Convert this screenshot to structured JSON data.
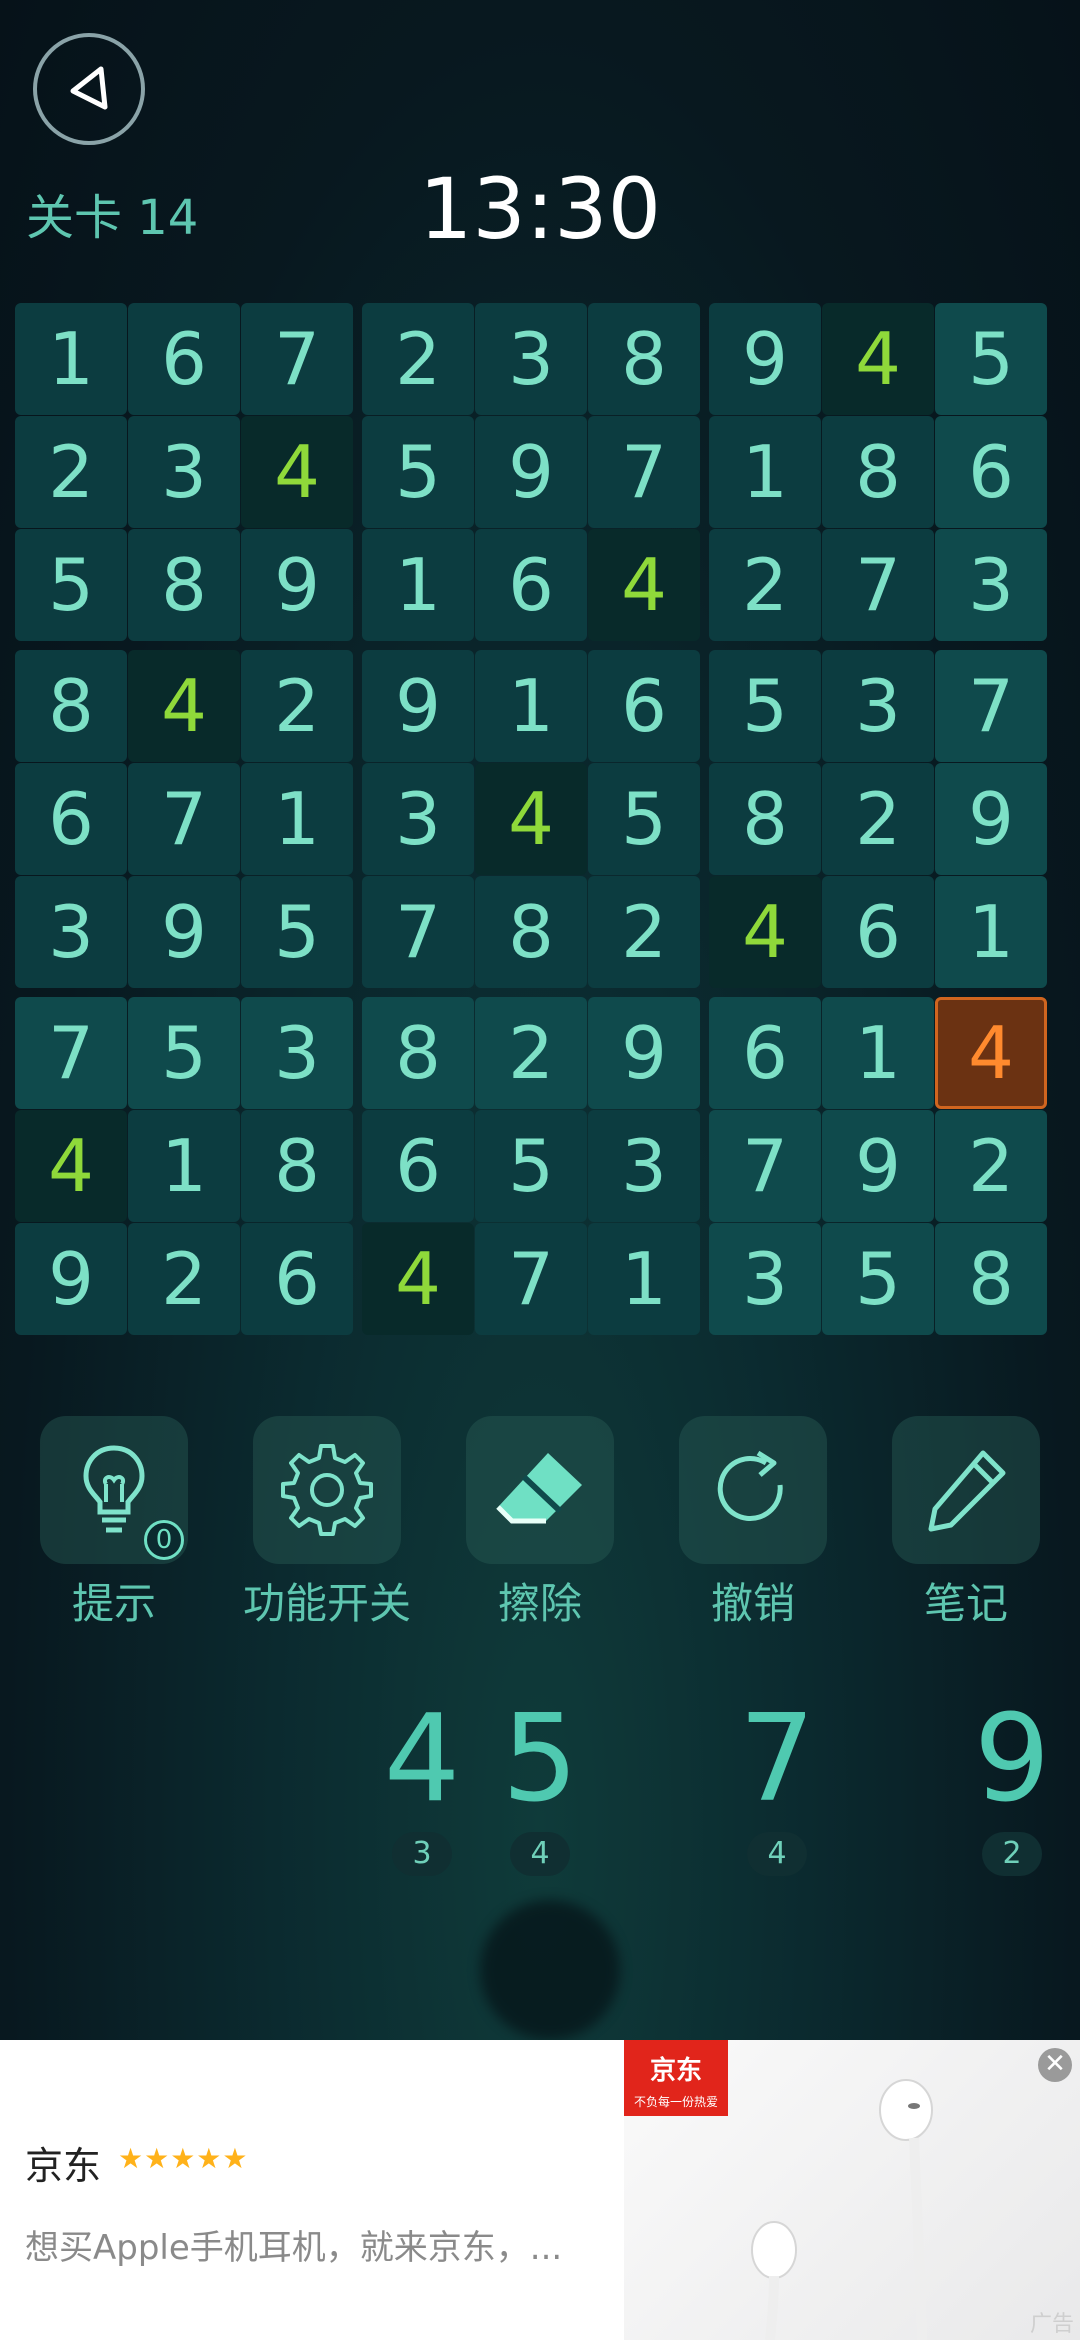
{
  "header": {
    "level": "关卡 14",
    "timer": "13:30"
  },
  "board": [
    [
      "1",
      "6",
      "7",
      "2",
      "3",
      "8",
      "9",
      "4",
      "5"
    ],
    [
      "2",
      "3",
      "4",
      "5",
      "9",
      "7",
      "1",
      "8",
      "6"
    ],
    [
      "5",
      "8",
      "9",
      "1",
      "6",
      "4",
      "2",
      "7",
      "3"
    ],
    [
      "8",
      "4",
      "2",
      "9",
      "1",
      "6",
      "5",
      "3",
      "7"
    ],
    [
      "6",
      "7",
      "1",
      "3",
      "4",
      "5",
      "8",
      "2",
      "9"
    ],
    [
      "3",
      "9",
      "5",
      "7",
      "8",
      "2",
      "4",
      "6",
      "1"
    ],
    [
      "7",
      "5",
      "3",
      "8",
      "2",
      "9",
      "6",
      "1",
      "4"
    ],
    [
      "4",
      "1",
      "8",
      "6",
      "5",
      "3",
      "7",
      "9",
      "2"
    ],
    [
      "9",
      "2",
      "6",
      "4",
      "7",
      "1",
      "3",
      "5",
      "8"
    ]
  ],
  "selected_cell": {
    "row": 6,
    "col": 8
  },
  "highlight_digit": "4",
  "tools": {
    "hint": {
      "label": "提示",
      "badge": "0"
    },
    "settings": {
      "label": "功能开关"
    },
    "erase": {
      "label": "擦除"
    },
    "undo": {
      "label": "撤销"
    },
    "notes": {
      "label": "笔记"
    }
  },
  "number_pad": [
    {
      "digit": "4",
      "count": "3"
    },
    {
      "digit": "5",
      "count": "4"
    },
    {
      "digit": "7",
      "count": "4"
    },
    {
      "digit": "9",
      "count": "2"
    }
  ],
  "ad": {
    "title": "京东",
    "stars": "★★★★★",
    "description": "想买Apple手机耳机，就来京东，...",
    "logo_text": "京东",
    "logo_slogan": "不负每一份热爱",
    "close": "✕",
    "mark": "广告"
  },
  "colors": {
    "selected": "#ff8a2e",
    "digit_four": "#8fd93a",
    "digit": "#7de0c6"
  }
}
